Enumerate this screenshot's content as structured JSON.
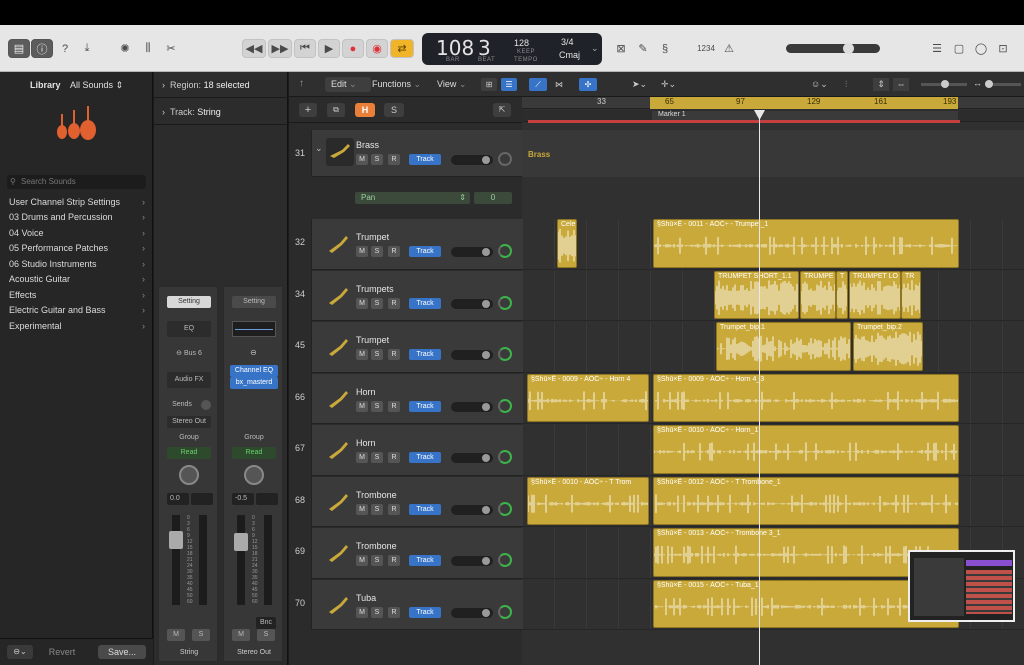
{
  "toolbar": {
    "lcd": {
      "bar": "108",
      "beat": "3",
      "bar_label": "BAR",
      "beat_label": "BEAT",
      "tempo": "128",
      "keep": "KEEP",
      "tempo_label": "TEMPO",
      "signature": "3/4",
      "key": "Cmaj"
    },
    "count_in": "1234"
  },
  "library": {
    "title": "Library",
    "sounds_filter": "All Sounds",
    "search_placeholder": "Search Sounds",
    "items": [
      "User Channel Strip Settings",
      "03 Drums and Percussion",
      "04 Voice",
      "05 Performance Patches",
      "06 Studio Instruments",
      "Acoustic Guitar",
      "Effects",
      "Electric Guitar and Bass",
      "Experimental"
    ],
    "revert": "Revert",
    "save": "Save..."
  },
  "inspector": {
    "region_label": "Region:",
    "region_value": "18 selected",
    "track_label": "Track:",
    "track_value": "String",
    "strip1": {
      "setting": "Setting",
      "eq": "EQ",
      "bus": "Bus 6",
      "audio_fx": "Audio FX",
      "sends": "Sends",
      "output": "Stereo Out",
      "group": "Group",
      "read": "Read",
      "value": "0.0",
      "m": "M",
      "s": "S",
      "name": "String"
    },
    "strip2": {
      "setting": "Setting",
      "plugin1": "Channel EQ",
      "plugin2": "bx_masterd",
      "group": "Group",
      "read": "Read",
      "value": "-0.5",
      "bnc": "Bnc",
      "m": "M",
      "s": "S",
      "name": "Stereo Out"
    },
    "meter_scale": [
      "0",
      "3",
      "6",
      "9",
      "12",
      "15",
      "18",
      "21",
      "24",
      "30",
      "35",
      "40",
      "45",
      "50",
      "60"
    ]
  },
  "arrange_toolbar": {
    "edit": "Edit",
    "functions": "Functions",
    "view": "View",
    "h": "H",
    "s": "S"
  },
  "ruler": {
    "bars": [
      "33",
      "65",
      "97",
      "129",
      "161",
      "193"
    ],
    "marker": "Marker 1"
  },
  "folder_track": {
    "number": "31",
    "name": "Brass",
    "pan": "Pan",
    "pan_value": "0",
    "region": "Brass"
  },
  "tracks": [
    {
      "number": "32",
      "name": "Trumpet"
    },
    {
      "number": "34",
      "name": "Trumpets"
    },
    {
      "number": "45",
      "name": "Trumpet"
    },
    {
      "number": "66",
      "name": "Horn"
    },
    {
      "number": "67",
      "name": "Horn"
    },
    {
      "number": "68",
      "name": "Trombone"
    },
    {
      "number": "69",
      "name": "Trombone"
    },
    {
      "number": "70",
      "name": "Tuba"
    }
  ],
  "track_button": {
    "m": "M",
    "s": "S",
    "r": "R",
    "track": "Track"
  },
  "regions": {
    "r32a": "Cele",
    "r32b": "§Šhū×Ë - 0011 - ÀÓČ÷ - Trumpet_1",
    "r34a": "TRUMPET SHORT_1.1",
    "r34b": "TRUMPE",
    "r34c": "T",
    "r34d": "TRUMPET LO",
    "r34e": "TR",
    "r45a": "Trumpet_bip.1",
    "r45b": "Trumpet_bip.2",
    "r66a": "§Šhū×Ë - 0009 - ÀÓČ÷ - Horn 4",
    "r66b": "§Šhū×Ë - 0009 - ÀÓČ÷ - Horn 4_3",
    "r67": "§Šhū×Ë - 0010 - ÀÓČ÷ - Horn_1",
    "r68a": "§Šhū×Ë - 0010 - ÀÓČ÷ - T Trom",
    "r68b": "§Šhū×Ë - 0012 - ÀÓČ÷ - T Trombone_1",
    "r69": "§Šhū×Ë - 0013 - ÀÓČ÷ - Trombone 3_1",
    "r70": "§Šhū×Ë - 0015 - ÀÓČ÷ - Tuba_1"
  },
  "colors": {
    "region": "#c9a93a",
    "track_button": "#3774c8",
    "accent_record": "#e0303a",
    "cycle": "#f0b429"
  }
}
